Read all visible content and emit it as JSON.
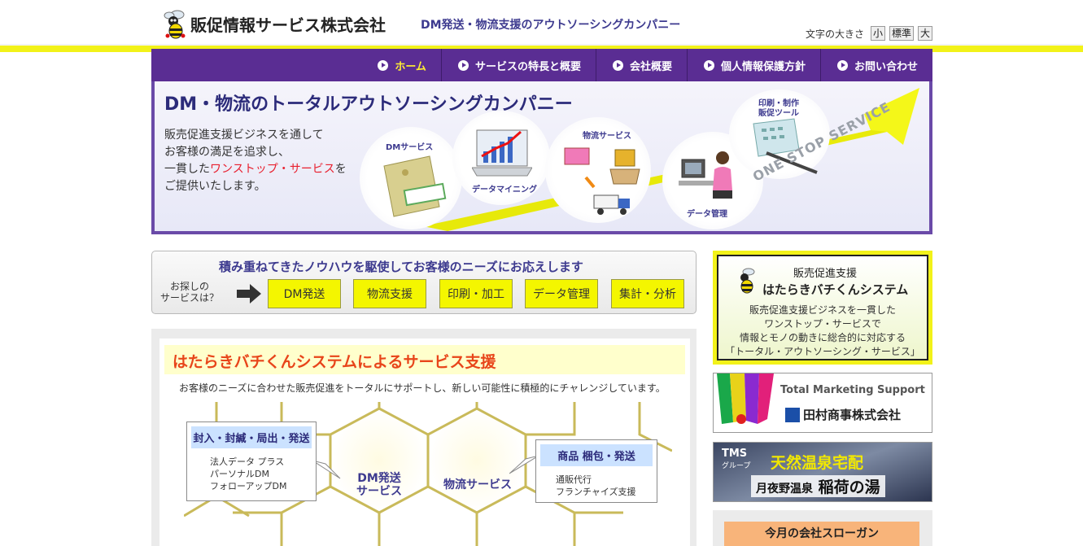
{
  "header": {
    "company_name": "販促情報サービス株式会社",
    "tagline": "DM発送・物流支援のアウトソーシングカンパニー",
    "font_size_label": "文字の大きさ",
    "font_size_small": "小",
    "font_size_standard": "標準",
    "font_size_large": "大"
  },
  "nav": {
    "items": [
      {
        "label": "ホーム"
      },
      {
        "label": "サービスの特長と概要"
      },
      {
        "label": "会社概要"
      },
      {
        "label": "個人情報保護方針"
      },
      {
        "label": "お問い合わせ"
      }
    ]
  },
  "hero": {
    "title": "DM・物流のトータルアウトソーシングカンパニー",
    "line1": "販売促進支援ビジネスを通して",
    "line2": "お客様の満足を追求し、",
    "line3_pre": "一貫した",
    "line3_red": "ワンストップ・サービス",
    "line3_post": "を",
    "line4": "ご提供いたします。",
    "label_dm": "DMサービス",
    "label_data_mining": "データマイニング",
    "label_logistics": "物流サービス",
    "label_data_mgmt": "データ管理",
    "label_print": "印刷・制作",
    "label_print2": "販促ツール",
    "one_stop": "ONE STOP SERVICE"
  },
  "finder": {
    "title": "積み重ねてきたノウハウを駆使してお客様のニーズにお応えします",
    "label1": "お探しの",
    "label2": "サービスは？",
    "buttons": [
      {
        "label": "DM発送"
      },
      {
        "label": "物流支援"
      },
      {
        "label": "印刷・加工"
      },
      {
        "label": "データ管理"
      },
      {
        "label": "集計・分析"
      }
    ]
  },
  "panel": {
    "heading": "はたらきバチくんシステムによるサービス支援",
    "description": "お客様のニーズに合わせた販売促進をトータルにサポートし、新しい可能性に積極的にチャレンジしています。",
    "callout_left": {
      "title": "封入・封緘・局出・発送",
      "items": [
        "法人データ プラス",
        "パーソナルDM",
        "フォローアップDM"
      ]
    },
    "callout_right": {
      "title": "商品 梱包・発送",
      "items": [
        "通販代行",
        "フランチャイズ支援"
      ]
    },
    "hex_dm_1": "DM発送",
    "hex_dm_2": "サービス",
    "hex_logistics": "物流サービス"
  },
  "sidebar": {
    "bee_small": "販売促進支援",
    "bee_big": "はたらきバチくんシステム",
    "bee_lines": [
      "販売促進支援ビジネスを一貫した",
      "ワンストップ・サービスで",
      "情報とモノの動きに総合的に対応する",
      "「トータル・アウトソーシング・サービス」"
    ],
    "tamura_sub": "Total Marketing Support",
    "tamura_name": "田村商事株式会社",
    "onsen_tms": "TMS",
    "onsen_group": "グループ",
    "onsen_title": "天然温泉宅配",
    "onsen_sub_small": "月夜野温泉",
    "onsen_sub_big": "稲荷の湯",
    "slogan": "今月の会社スローガン"
  },
  "colors": {
    "nav_bg": "#5a2d93",
    "accent_yellow": "#f2f219",
    "heading_orange": "#e8451a",
    "title_navy": "#2c2b7a"
  }
}
